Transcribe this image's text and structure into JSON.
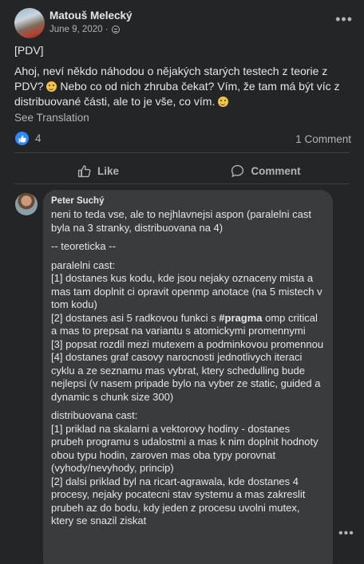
{
  "post": {
    "author": "Matouš Melecký",
    "date": "June 9, 2020 · ",
    "more_label": "•••",
    "tag": "[PDV]",
    "text_part1": "Ahoj, neví někdo náhodou o nějakých starých testech z teorie z PDV? ",
    "text_part2": " Nebo co od nich zhruba čekat? Vím, že tam má být víc z distribuované části, ale to je vše, co vím. ",
    "see_translation": "See Translation",
    "like_count": "4",
    "comment_count": "1 Comment",
    "like_label": "Like",
    "comment_label": "Comment"
  },
  "comment": {
    "author": "Peter Suchý",
    "lines": {
      "intro": "neni to teda vse, ale to nejhlavnejsi aspon (paralelni cast byla na 3 stranky, distribuovana na 4)",
      "theory": "-- teoreticka --",
      "paralel_header": "paralelni cast:",
      "p1": "[1] dostanes kus kodu, kde jsou nejaky oznaceny mista a mas tam doplnit ci opravit openmp anotace (na 5 mistech v tom kodu)",
      "p2a": "[2] dostanes asi 5 radkovou funkci s ",
      "p2_bold": "#pragma",
      "p2b": " omp critical a mas to prepsat na variantu s atomickymi promennymi",
      "p3": "[3] popsat rozdil mezi mutexem a podminkovou promennou",
      "p4": "[4] dostanes graf casovy narocnosti jednotlivych iteraci cyklu a ze seznamu mas vybrat, ktery schedulling bude nejlepsi (v nasem pripade bylo na vyber ze static, guided a dynamic s chunk size 300)",
      "dist_header": "distribuovana cast:",
      "d1": "[1] priklad na skalarni a vektorovy hodiny - dostanes prubeh programu s udalostmi a mas k nim doplnit hodnoty obou typu hodin, zaroven mas oba typy porovnat (vyhody/nevyhody, princip)",
      "d2": "[2] dalsi priklad byl na ricart-agrawala, kde dostanes 4 procesy, nejaky pocatecni stav systemu a mas zakreslit prubeh az do bodu, kdy jeden z procesu uvolni mutex, ktery se snazil ziskat"
    },
    "more_label": "•••"
  }
}
